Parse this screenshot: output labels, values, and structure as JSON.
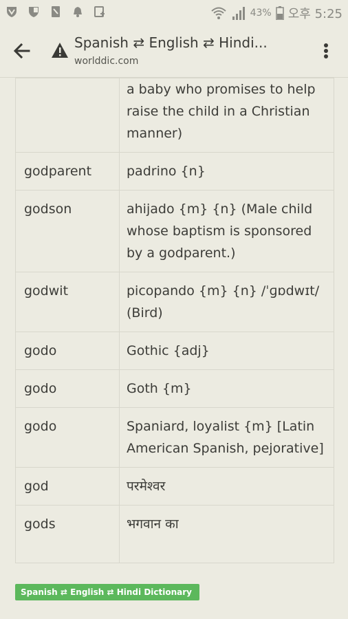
{
  "status_bar": {
    "battery_percent": "43%",
    "time": "오후 5:25"
  },
  "toolbar": {
    "title": "Spanish ⇄ English ⇄ Hindi...",
    "url": "worlddic.com"
  },
  "table": {
    "partial_row": "a baby who promises to help raise the child in a Christian manner)",
    "rows": [
      {
        "term": "godparent",
        "translation": "padrino {n}"
      },
      {
        "term": "godson",
        "translation": "ahijado {m} {n} (Male child whose baptism is sponsored by a godparent.)"
      },
      {
        "term": "godwit",
        "translation": "picopando {m} {n} /ˈɡɒdwɪt/ (Bird)"
      },
      {
        "term": "godo",
        "translation": "Gothic {adj}"
      },
      {
        "term": "godo",
        "translation": "Goth {m}"
      },
      {
        "term": "godo",
        "translation": "Spaniard, loyalist {m} [Latin American Spanish, pejorative]"
      },
      {
        "term": "god",
        "translation": "परमेश्वर"
      },
      {
        "term": "gods",
        "translation": "भगवान का"
      }
    ]
  },
  "footer": {
    "badge": "Spanish ⇄ English ⇄ Hindi Dictionary"
  }
}
